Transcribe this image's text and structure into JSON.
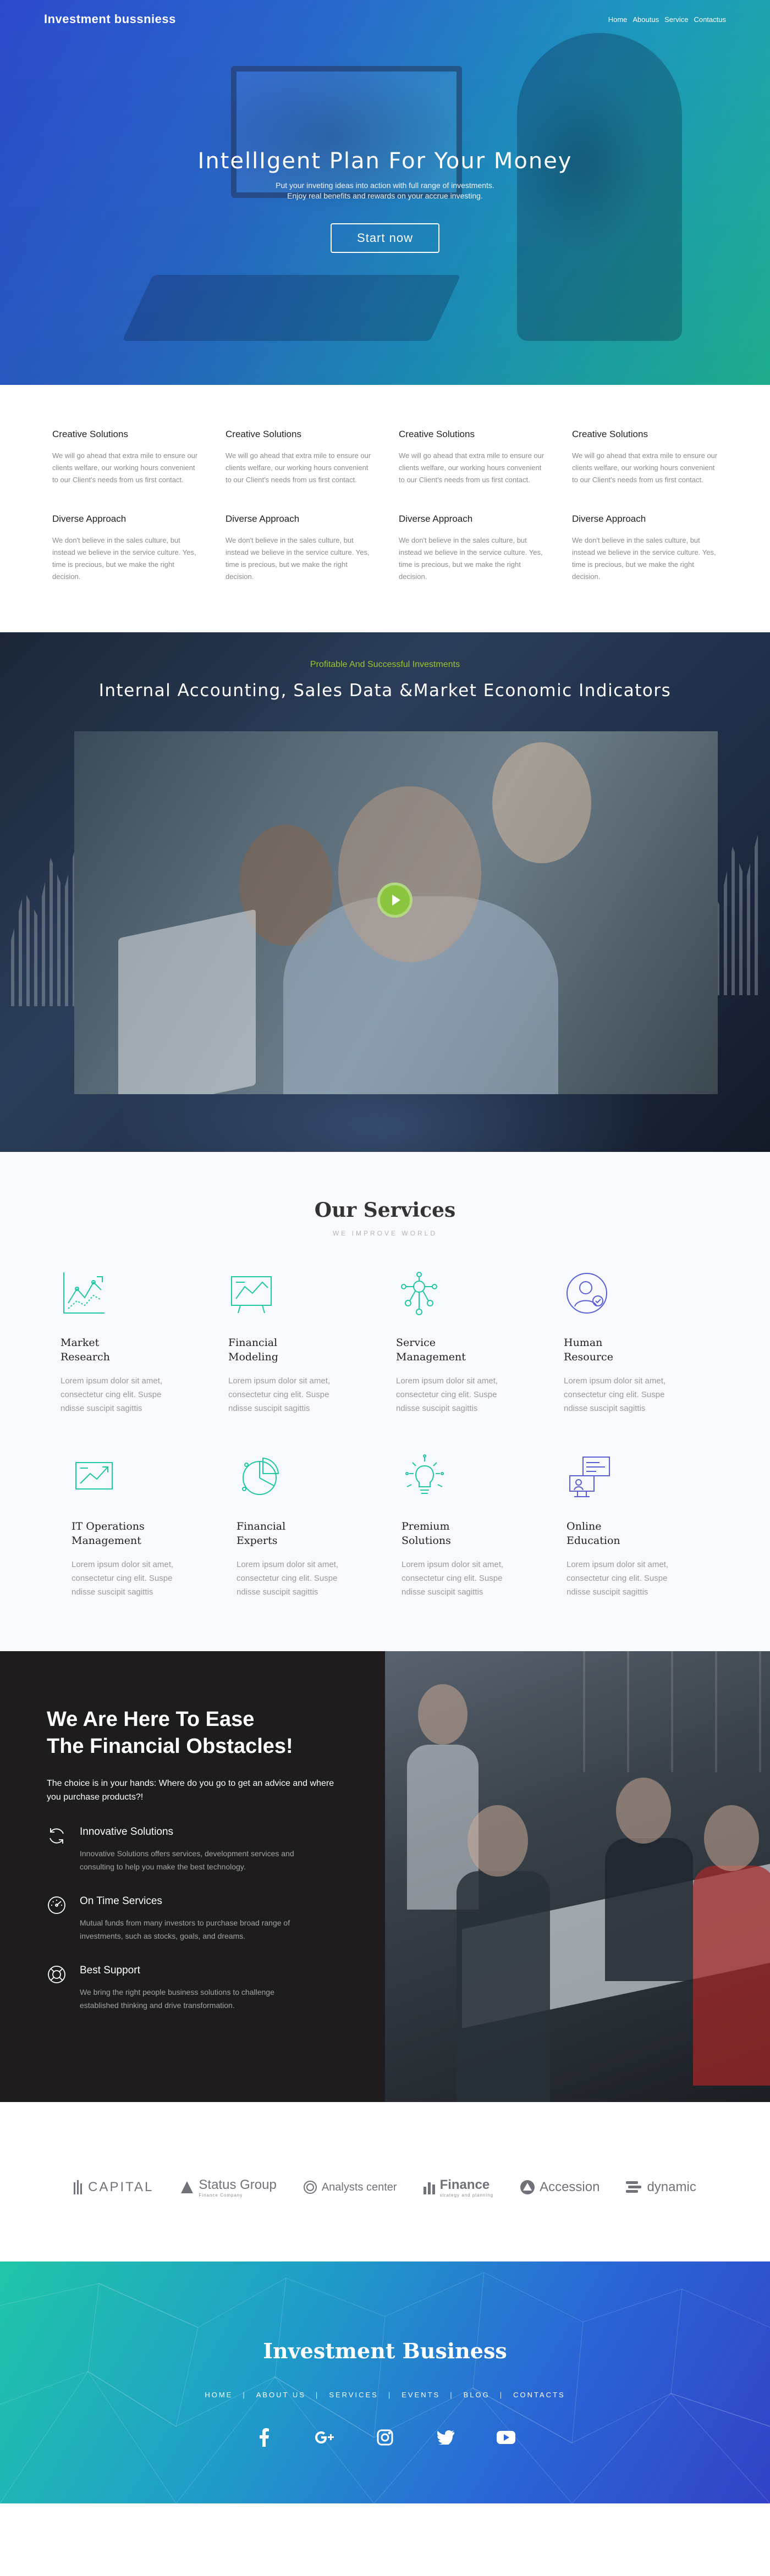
{
  "brand": "Investment bussniess",
  "nav": [
    "Home",
    "Aboutus",
    "Service",
    "Contactus"
  ],
  "hero": {
    "title": "IntellIgent Plan For Your Money",
    "line1": "Put your inveting ideas into action with full range of investments.",
    "line2": "Enjoy real benefits and rewards on your accrue investing.",
    "cta": "Start now"
  },
  "features": [
    {
      "title": "Creative Solutions",
      "text": "We will go ahead that extra mile to ensure our clients welfare, our working hours convenient to our Client's needs from us first contact."
    },
    {
      "title": "Creative Solutions",
      "text": "We will go ahead that extra mile to ensure our clients welfare, our working hours convenient to our Client's needs from us first contact."
    },
    {
      "title": "Creative Solutions",
      "text": "We will go ahead that extra mile to ensure our clients welfare, our working hours convenient to our Client's needs from us first contact."
    },
    {
      "title": "Creative Solutions",
      "text": "We will go ahead that extra mile to ensure our clients welfare, our working hours convenient to our Client's needs from us first contact."
    },
    {
      "title": "Diverse Approach",
      "text": "We don't believe in the sales culture, but instead we believe in the service culture. Yes, time is precious, but we make the right decision."
    },
    {
      "title": "Diverse Approach",
      "text": "We don't believe in the sales culture, but instead we believe in the service culture. Yes, time is precious, but we make the right decision."
    },
    {
      "title": "Diverse Approach",
      "text": "We don't believe in the sales culture, but instead we believe in the service culture. Yes, time is precious, but we make the right decision."
    },
    {
      "title": "Diverse Approach",
      "text": "We don't believe in the sales culture, but instead we believe in the service culture. Yes, time is precious, but we make the right decision."
    }
  ],
  "video": {
    "kicker": "Profitable And Successful Investments",
    "title": "Internal Accounting, Sales Data &Market Economic Indicators"
  },
  "services": {
    "title": "Our Services",
    "subtitle": "WE IMPROVE WORLD",
    "items": [
      {
        "l1": "Market",
        "l2": "Research",
        "text": "Lorem ipsum dolor sit amet, consectetur cing elit. Suspe ndisse suscipit sagittis",
        "icon": "chart-icon",
        "color": "#1fc7a3"
      },
      {
        "l1": "Financial",
        "l2": "Modeling",
        "text": "Lorem ipsum dolor sit amet, consectetur cing elit. Suspe ndisse suscipit sagittis",
        "icon": "graph-board-icon",
        "color": "#1fc7a3"
      },
      {
        "l1": "Service",
        "l2": "Management",
        "text": "Lorem ipsum dolor sit amet, consectetur cing elit. Suspe ndisse suscipit sagittis",
        "icon": "network-icon",
        "color": "#1fc7a3"
      },
      {
        "l1": "Human",
        "l2": "Resource",
        "text": "Lorem ipsum dolor sit amet, consectetur cing elit. Suspe ndisse suscipit sagittis",
        "icon": "person-icon",
        "color": "#5a5fd6"
      },
      {
        "l1": "IT Operations",
        "l2": "Management",
        "text": "Lorem ipsum dolor sit amet, consectetur cing elit. Suspe ndisse suscipit sagittis",
        "icon": "trend-icon",
        "color": "#1fc7a3"
      },
      {
        "l1": "Financial",
        "l2": "Experts",
        "text": "Lorem ipsum dolor sit amet, consectetur cing elit. Suspe ndisse suscipit sagittis",
        "icon": "pie-chart-icon",
        "color": "#1fc7a3"
      },
      {
        "l1": "Premium",
        "l2": "Solutions",
        "text": "Lorem ipsum dolor sit amet, consectetur cing elit. Suspe ndisse suscipit sagittis",
        "icon": "lightbulb-icon",
        "color": "#1fc7a3"
      },
      {
        "l1": "Online",
        "l2": "Education",
        "text": "Lorem ipsum dolor sit amet, consectetur cing elit. Suspe ndisse suscipit sagittis",
        "icon": "presentation-icon",
        "color": "#5a5fd6"
      }
    ]
  },
  "ease": {
    "title1": "We Are Here To Ease",
    "title2": "The Financial Obstacles!",
    "lead": "The choice is in your hands: Where do you go to get an advice and where you purchase products?!",
    "items": [
      {
        "title": "Innovative Solutions",
        "text": "Innovative Solutions offers services, development services and consulting to help you make the best technology."
      },
      {
        "title": "On Time Services",
        "text": "Mutual funds from many investors to purchase broad range of investments, such as stocks, goals, and dreams."
      },
      {
        "title": "Best Support",
        "text": "We bring the right people business solutions to challenge established thinking and drive transformation."
      }
    ]
  },
  "partners": [
    {
      "name": "CAPITAL",
      "tag": ""
    },
    {
      "name": "Status Group",
      "tag": "Finance Company"
    },
    {
      "name": "Analysts center",
      "tag": ""
    },
    {
      "name": "Finance",
      "tag": "strategy and planning"
    },
    {
      "name": "Accession",
      "tag": ""
    },
    {
      "name": "dynamic",
      "tag": ""
    }
  ],
  "footer": {
    "brand": "Investment Business",
    "nav": [
      "HOME",
      "ABOUT US",
      "SERVICES",
      "EVENTS",
      "BLOG",
      "CONTACTS"
    ],
    "socials": [
      "facebook-icon",
      "google-plus-icon",
      "instagram-icon",
      "twitter-icon",
      "youtube-icon"
    ]
  }
}
